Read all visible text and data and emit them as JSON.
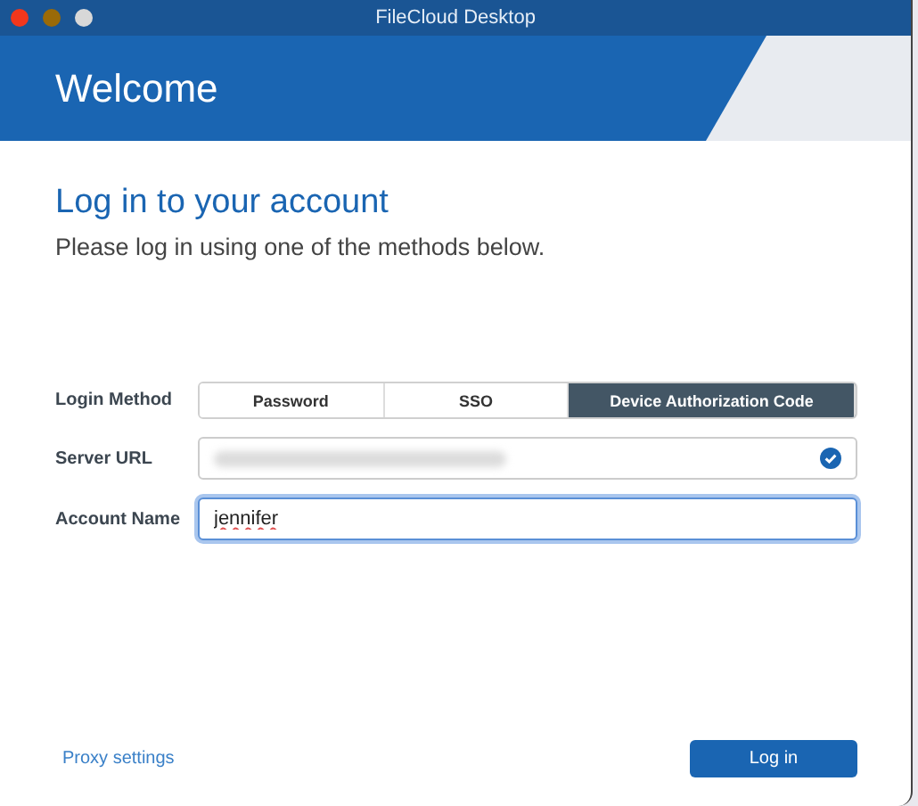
{
  "window": {
    "title": "FileCloud Desktop"
  },
  "header": {
    "title": "Welcome"
  },
  "heading": "Log in to your account",
  "subtitle": "Please log in using one of the methods below.",
  "login_method": {
    "label": "Login Method",
    "options": [
      {
        "label": "Password",
        "selected": false
      },
      {
        "label": "SSO",
        "selected": false
      },
      {
        "label": "Device Authorization Code",
        "selected": true
      }
    ]
  },
  "server_url": {
    "label": "Server URL",
    "verified": true
  },
  "account_name": {
    "label": "Account Name",
    "value": "jennifer",
    "focused": true
  },
  "proxy_link": "Proxy settings",
  "login_button": "Log in"
}
